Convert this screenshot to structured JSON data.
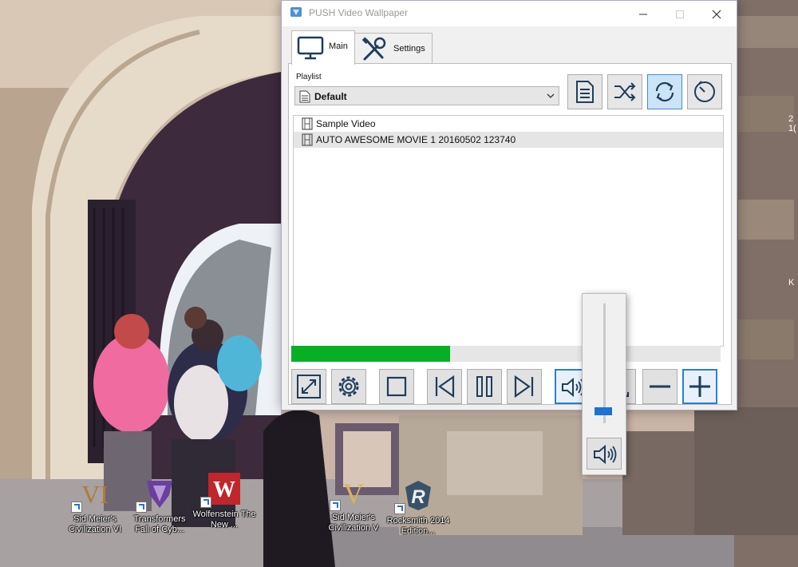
{
  "window": {
    "title": "PUSH Video Wallpaper",
    "tabs": [
      {
        "label": "Main",
        "active": true
      },
      {
        "label": "Settings",
        "active": false
      }
    ]
  },
  "playlist": {
    "label": "Playlist",
    "selected": "Default",
    "items": [
      {
        "name": "Sample Video",
        "selected": false
      },
      {
        "name": "AUTO AWESOME MOVIE 1 20160502 123740",
        "selected": true
      }
    ]
  },
  "playback": {
    "progress": 0.37
  },
  "volume": {
    "level": 0.1
  },
  "desktop_icons": [
    {
      "label": "Sid Meier's Civilization VI"
    },
    {
      "label": "Transformers Fall of Cyb..."
    },
    {
      "label": "Wolfenstein The New ..."
    },
    {
      "label": "Sid Meier's Civilization V"
    },
    {
      "label": "Rocksmith 2014 Edition..."
    }
  ],
  "edge_text": {
    "top": "2 1(",
    "middle": "K"
  },
  "colors": {
    "accent": "#2a7fd4",
    "progress": "#06b025",
    "volume_thumb": "#1a73d9"
  },
  "icons": {
    "app": "push-app-icon",
    "tab_main": "monitor-icon",
    "tab_settings": "tools-icon",
    "playlist_actions": [
      "document-icon",
      "shuffle-icon",
      "repeat-icon",
      "timer-icon"
    ],
    "controls": [
      "fullscreen-icon",
      "gear-icon",
      "stop-icon",
      "previous-icon",
      "pause-icon",
      "next-icon",
      "speaker-icon",
      "download-icon",
      "minus-icon",
      "plus-icon"
    ]
  }
}
